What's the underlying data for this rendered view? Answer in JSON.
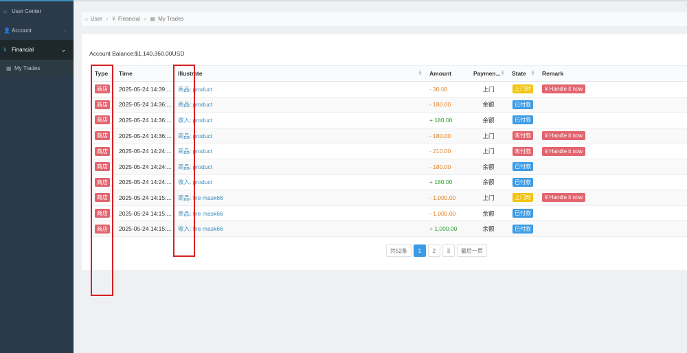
{
  "sidebar": {
    "items": [
      {
        "icon": "home-icon",
        "glyph": "⌂",
        "label": "User Center"
      },
      {
        "icon": "user-icon",
        "glyph": "👤",
        "label": "Account",
        "chevron": "‹"
      },
      {
        "icon": "yen-icon",
        "glyph": "¥",
        "label": "Financial",
        "chevron": "⌄"
      },
      {
        "icon": "calendar-icon",
        "glyph": "▦",
        "label": "My Trades"
      }
    ]
  },
  "breadcrumb": [
    {
      "icon": "home-icon",
      "glyph": "⌂",
      "label": "User"
    },
    {
      "icon": "yen-icon",
      "glyph": "¥",
      "label": "Financial"
    },
    {
      "icon": "calendar-icon",
      "glyph": "▦",
      "label": "My Trades"
    }
  ],
  "balance": "Account Balance:$1,140,360.00USD",
  "table": {
    "headers": [
      "Type",
      "Time",
      "Illustrate",
      "Amount",
      "Paymen...",
      "State",
      "Remark"
    ],
    "rows": [
      {
        "type": "商店",
        "time": "2025-05-24 14:39:...",
        "illustrate": "商品: product",
        "amount": "- 30.00",
        "sign": "neg",
        "payment": "上门",
        "state": "上门时",
        "state_color": "yellow",
        "remark": "¥ Handle it now"
      },
      {
        "type": "商店",
        "time": "2025-05-24 14:36:...",
        "illustrate": "商品: product",
        "amount": "- 180.00",
        "sign": "neg",
        "payment": "余额",
        "state": "已付款",
        "state_color": "blue",
        "remark": ""
      },
      {
        "type": "商店",
        "time": "2025-05-24 14:36:...",
        "illustrate": "收入: product",
        "amount": "+ 180.00",
        "sign": "pos",
        "payment": "余额",
        "state": "已付款",
        "state_color": "blue",
        "remark": ""
      },
      {
        "type": "商店",
        "time": "2025-05-24 14:36:...",
        "illustrate": "商品: product",
        "amount": "- 180.00",
        "sign": "neg",
        "payment": "上门",
        "state": "未付款",
        "state_color": "red",
        "remark": "¥ Handle it now"
      },
      {
        "type": "商店",
        "time": "2025-05-24 14:24:...",
        "illustrate": "商品: product",
        "amount": "- 210.00",
        "sign": "neg",
        "payment": "上门",
        "state": "未付款",
        "state_color": "red",
        "remark": "¥ Handle it now"
      },
      {
        "type": "商店",
        "time": "2025-05-24 14:24:...",
        "illustrate": "商品: product",
        "amount": "- 180.00",
        "sign": "neg",
        "payment": "余额",
        "state": "已付款",
        "state_color": "blue",
        "remark": ""
      },
      {
        "type": "商店",
        "time": "2025-05-24 14:24:...",
        "illustrate": "收入: product",
        "amount": "+ 180.00",
        "sign": "pos",
        "payment": "余额",
        "state": "已付款",
        "state_color": "blue",
        "remark": ""
      },
      {
        "type": "商店",
        "time": "2025-05-24 14:15:...",
        "illustrate": "商品: fire mask66",
        "amount": "- 1,000.00",
        "sign": "neg",
        "payment": "上门",
        "state": "上门时",
        "state_color": "yellow",
        "remark": "¥ Handle it now"
      },
      {
        "type": "商店",
        "time": "2025-05-24 14:15:...",
        "illustrate": "商品: fire mask66",
        "amount": "- 1,000.00",
        "sign": "neg",
        "payment": "余额",
        "state": "已付款",
        "state_color": "blue",
        "remark": ""
      },
      {
        "type": "商店",
        "time": "2025-05-24 14:15:...",
        "illustrate": "收入: fire mask66",
        "amount": "+ 1,000.00",
        "sign": "pos",
        "payment": "余额",
        "state": "已付款",
        "state_color": "blue",
        "remark": ""
      }
    ]
  },
  "pagination": {
    "total": "共52条",
    "pages": [
      "1",
      "2",
      "3"
    ],
    "current": "1",
    "last": "最后一页"
  },
  "colors": {
    "accent": "#3c9be6",
    "danger": "#e2646e",
    "warning": "#f1c40f",
    "negative_amount": "#e67e22",
    "positive_amount": "#2e9a2e",
    "highlight": "#d71f1f"
  }
}
